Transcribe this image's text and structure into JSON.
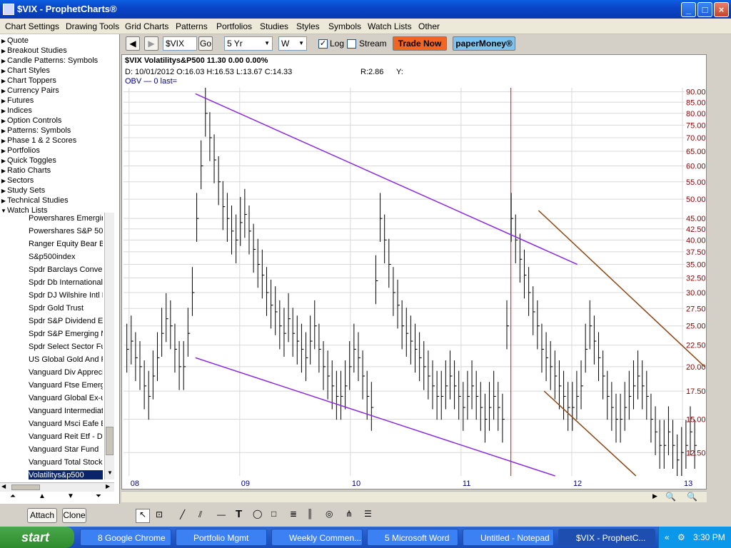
{
  "window": {
    "title": "$VIX - ProphetCharts®"
  },
  "menu": [
    "Chart Settings",
    "Drawing Tools",
    "Grid Charts",
    "Patterns",
    "Portfolios",
    "Studies",
    "Styles",
    "Symbols",
    "Watch Lists",
    "Other"
  ],
  "sidebar": {
    "categories": [
      "Quote",
      "Breakout Studies",
      "Candle Patterns: Symbols",
      "Chart Styles",
      "Chart Toppers",
      "Currency Pairs",
      "Futures",
      "Indices",
      "Option Controls",
      "Patterns: Symbols",
      "Phase 1 & 2 Scores",
      "Portfolios",
      "Quick Toggles",
      "Ratio Charts",
      "Sectors",
      "Study Sets",
      "Technical Studies",
      "Watch Lists"
    ],
    "watchlist": [
      "Powershares Emergin",
      "Powershares S&P 500",
      "Ranger Equity Bear Be",
      "S&p500index",
      "Spdr Barclays Conver",
      "Spdr Db International",
      "Spdr DJ Wilshire Intl R",
      "Spdr Gold Trust",
      "Spdr S&P Dividend Etf",
      "Spdr S&P Emerging M",
      "Spdr Select Sector Fu",
      "US Global Gold And Pr",
      "Vanguard Div Appreci",
      "Vanguard Ftse Emerg",
      "Vanguard Global Ex-u",
      "Vanguard Intermediat",
      "Vanguard Msci Eafe E",
      "Vanguard Reit Etf - Di",
      "Vanguard Star Fund",
      "Vanguard Total Stock",
      "Volatilitys&p500"
    ],
    "attach_label": "Attach",
    "clone_label": "Clone"
  },
  "toolbar": {
    "symbol": "$VIX",
    "go_label": "Go",
    "range": "5 Yr",
    "interval": "W",
    "log_label": "Log",
    "log_checked": "✓",
    "stream_label": "Stream",
    "trade_now_label": "Trade Now",
    "paper_money_label": "paperMoney®"
  },
  "chart": {
    "header": "$VIX Volatilitys&P500   11.30   0.00   0.00%",
    "ohlc": "D: 10/01/2012 O:16.03 H:16.53 L:13.67 C:14.33",
    "r_label": "R:2.86",
    "y_label": "Y:",
    "obv": "OBV — 0 last="
  },
  "chart_data": {
    "type": "line",
    "title": "$VIX Volatilitys&P500",
    "x_ticks": [
      "08",
      "09",
      "10",
      "11",
      "12",
      "13"
    ],
    "y_ticks": [
      "90.00",
      "85.00",
      "80.00",
      "75.00",
      "70.00",
      "65.00",
      "60.00",
      "55.00",
      "50.00",
      "45.00",
      "42.50",
      "40.00",
      "37.50",
      "35.00",
      "32.50",
      "30.00",
      "27.50",
      "25.00",
      "22.50",
      "20.00",
      "17.50",
      "15.00",
      "12.50"
    ],
    "log_scale": true,
    "ylim": [
      11,
      92
    ],
    "trendlines": [
      {
        "color": "#8a2be2",
        "from": {
          "x": 2008.6,
          "y": 89
        },
        "to": {
          "x": 2012.05,
          "y": 35
        }
      },
      {
        "color": "#8a2be2",
        "from": {
          "x": 2008.6,
          "y": 21
        },
        "to": {
          "x": 2011.85,
          "y": 11
        }
      },
      {
        "color": "#8b4513",
        "from": {
          "x": 2011.7,
          "y": 47
        },
        "to": {
          "x": 2013.2,
          "y": 20
        }
      },
      {
        "color": "#8b4513",
        "from": {
          "x": 2011.75,
          "y": 17.5
        },
        "to": {
          "x": 2012.58,
          "y": 11
        }
      }
    ],
    "closes": [
      22,
      23,
      21,
      20,
      18,
      17,
      19,
      21,
      24,
      26,
      25,
      22,
      20,
      20,
      24,
      30,
      45,
      60,
      80,
      70,
      62,
      55,
      48,
      45,
      42,
      40,
      44,
      46,
      42,
      38,
      35,
      33,
      30,
      28,
      27,
      25,
      24,
      26,
      24,
      23,
      22,
      21,
      23,
      25,
      22,
      20,
      19,
      18,
      17,
      17,
      18,
      20,
      22,
      21,
      19,
      17,
      16,
      32,
      45,
      40,
      35,
      30,
      28,
      25,
      24,
      23,
      22,
      21,
      20,
      19,
      18,
      17,
      17,
      18,
      19,
      18,
      17,
      16,
      17,
      18,
      17,
      16,
      15,
      16,
      17,
      16,
      15,
      25,
      45,
      40,
      36,
      33,
      30,
      27,
      25,
      22,
      21,
      20,
      19,
      18,
      17,
      16,
      16,
      17,
      18,
      22,
      25,
      23,
      21,
      19,
      17,
      16,
      15,
      15,
      16,
      17,
      18,
      19,
      18,
      17,
      15,
      14,
      13,
      13,
      14,
      13,
      12,
      12.5,
      13,
      14,
      13
    ]
  },
  "draw_tools": [
    "cursor",
    "zoom",
    "line",
    "parallel",
    "hline",
    "text",
    "ellipse",
    "rect",
    "fib",
    "gann",
    "cycles",
    "pitchfork",
    "menu"
  ],
  "taskbar": {
    "start_label": "start",
    "tasks": [
      "8 Google Chrome",
      "Portfolio Mgmt",
      "Weekly Commen...",
      "5 Microsoft Word",
      "Untitled - Notepad",
      "$VIX - ProphetC..."
    ],
    "clock": "3:30 PM"
  },
  "colors": {
    "titlebar": "#0a46c8",
    "trend_purple": "#8a2be2",
    "trend_brown": "#8b4513",
    "cursor_red": "#ff0000",
    "trade_now": "#f26522",
    "paper_money": "#4aa3df"
  }
}
